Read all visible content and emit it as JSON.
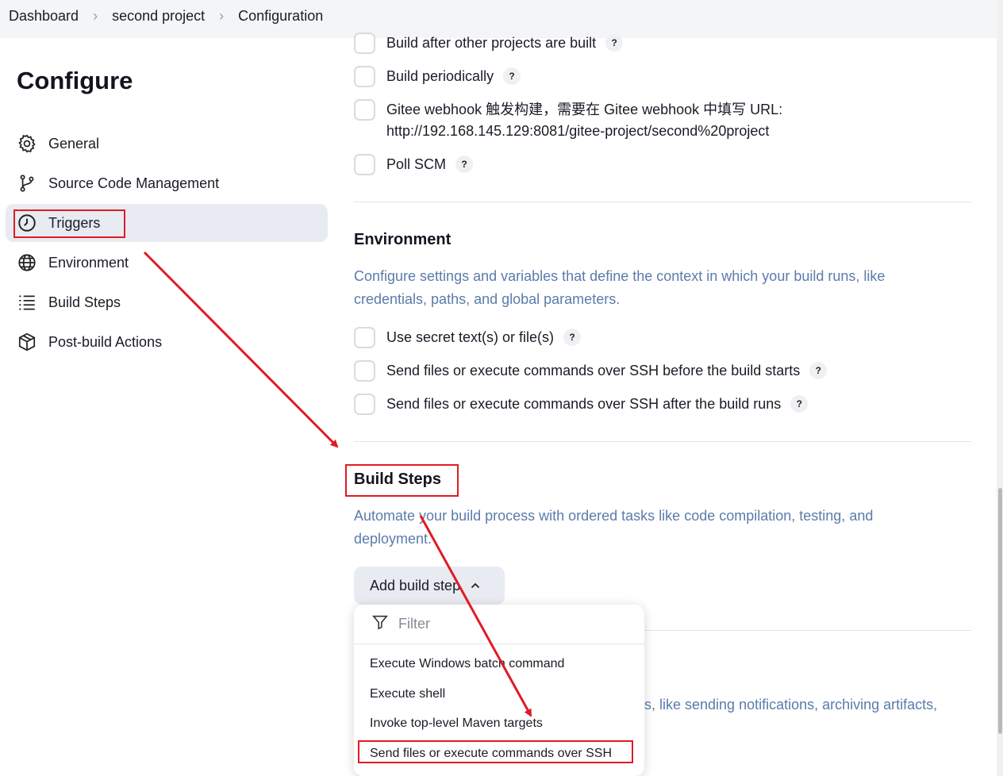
{
  "breadcrumb": {
    "items": [
      "Dashboard",
      "second project",
      "Configuration"
    ]
  },
  "page": {
    "title": "Configure"
  },
  "sidebar": {
    "items": [
      {
        "label": "General",
        "icon": "gear-icon"
      },
      {
        "label": "Source Code Management",
        "icon": "branch-icon"
      },
      {
        "label": "Triggers",
        "icon": "clock-icon",
        "active": true
      },
      {
        "label": "Environment",
        "icon": "globe-icon"
      },
      {
        "label": "Build Steps",
        "icon": "list-icon"
      },
      {
        "label": "Post-build Actions",
        "icon": "package-icon"
      }
    ]
  },
  "triggers": {
    "options": [
      {
        "label": "Build after other projects are built",
        "help": "?"
      },
      {
        "label": "Build periodically",
        "help": "?"
      },
      {
        "label": "Gitee webhook 触发构建，需要在 Gitee webhook 中填写 URL:",
        "label2": "http://192.168.145.129:8081/gitee-project/second%20project"
      },
      {
        "label": "Poll SCM",
        "help": "?"
      }
    ]
  },
  "environment": {
    "title": "Environment",
    "description": "Configure settings and variables that define the context in which your build runs, like credentials, paths, and global parameters.",
    "options": [
      {
        "label": "Use secret text(s) or file(s)",
        "help": "?"
      },
      {
        "label": "Send files or execute commands over SSH before the build starts",
        "help": "?"
      },
      {
        "label": "Send files or execute commands over SSH after the build runs",
        "help": "?"
      }
    ]
  },
  "build_steps": {
    "title": "Build Steps",
    "description": "Automate your build process with ordered tasks like code compilation, testing, and deployment.",
    "add_button": "Add build step",
    "filter_placeholder": "Filter",
    "menu": [
      "Execute Windows batch command",
      "Execute shell",
      "Invoke top-level Maven targets",
      "Send files or execute commands over SSH"
    ]
  },
  "post_build": {
    "description_fragment": "s, like sending notifications, archiving artifacts,"
  },
  "colors": {
    "annotation_red": "#e01b24",
    "description_blue": "#5b7bab",
    "active_nav_bg": "#e8ebf1"
  }
}
